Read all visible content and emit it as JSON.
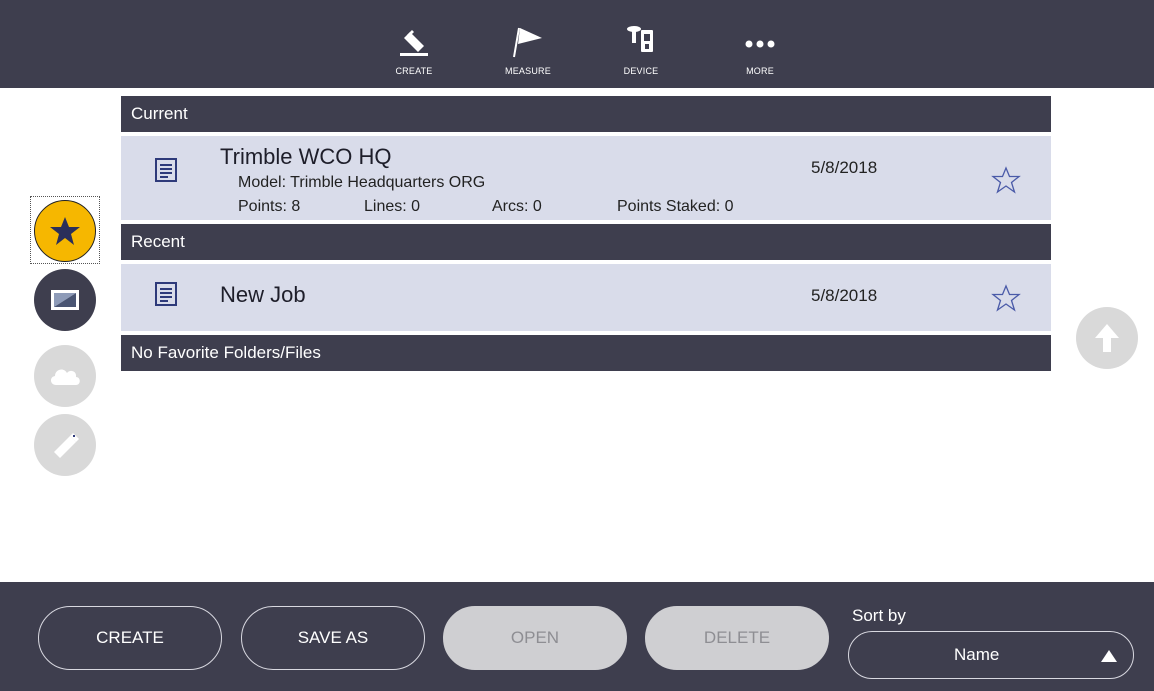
{
  "toolbar": {
    "create_label": "CREATE",
    "measure_label": "MEASURE",
    "device_label": "DEVICE",
    "more_label": "MORE"
  },
  "sidebar": {
    "items": [
      {
        "name": "favorites",
        "icon": "star-icon",
        "selected": true
      },
      {
        "name": "device",
        "icon": "tablet-icon",
        "selected": false
      },
      {
        "name": "cloud",
        "icon": "cloud-icon",
        "selected": false
      },
      {
        "name": "usb",
        "icon": "usb-drive-icon",
        "selected": false
      }
    ]
  },
  "sections": {
    "current": "Current",
    "recent": "Recent",
    "favorites_empty": "No Favorite Folders/Files"
  },
  "current_job": {
    "name": "Trimble WCO HQ",
    "model": "Model: Trimble Headquarters ORG",
    "points": "Points: 8",
    "lines": "Lines: 0",
    "arcs": "Arcs: 0",
    "points_staked": "Points Staked: 0",
    "date": "5/8/2018",
    "icon": "document-icon",
    "favorite": false
  },
  "recent_job": {
    "name": "New Job",
    "date": "5/8/2018",
    "icon": "document-icon",
    "favorite": false
  },
  "bottombar": {
    "create_label": "CREATE",
    "save_as_label": "SAVE AS",
    "open_label": "OPEN",
    "delete_label": "DELETE",
    "sort_by_label": "Sort by",
    "sort_value": "Name"
  },
  "colors": {
    "bar": "#3e3e4e",
    "row": "#d9dcea",
    "accent": "#f6b700",
    "disabled": "#cfcfd2",
    "icon_blue": "#2e3a7a"
  }
}
